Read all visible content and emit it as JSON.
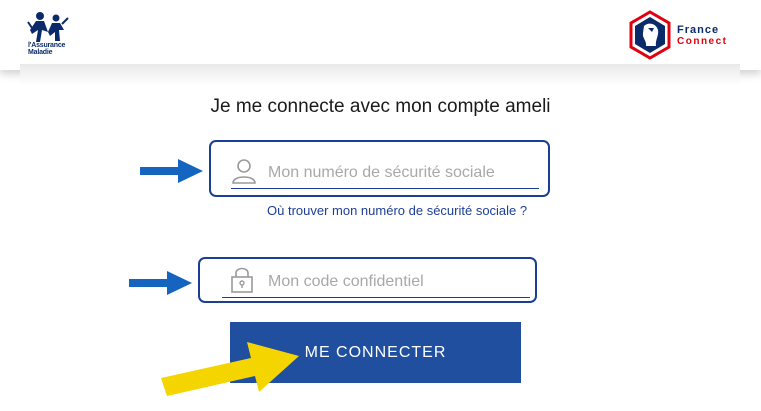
{
  "header": {
    "ameli_logo_text": "l'Assurance Maladie",
    "franceconnect_line1": "France",
    "franceconnect_line2": "Connect"
  },
  "form": {
    "title": "Je me connecte avec mon compte ameli",
    "nir_placeholder": "Mon numéro de sécurité sociale",
    "nir_help_link": "Où trouver mon numéro de sécurité sociale ?",
    "code_placeholder": "Mon code confidentiel",
    "submit_label": "ME CONNECTER"
  },
  "colors": {
    "primary": "#1f4f9e",
    "field_border": "#1c3f95",
    "arrow_blue": "#1565c0",
    "arrow_yellow": "#f5d500",
    "franceconnect_red": "#e1000f"
  },
  "icons": [
    "ameli-logo-icon",
    "franceconnect-logo-icon",
    "user-icon",
    "lock-icon"
  ]
}
